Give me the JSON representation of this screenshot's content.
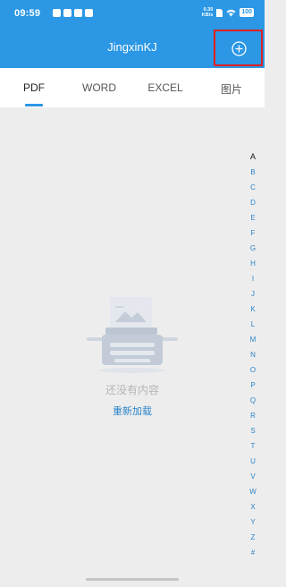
{
  "status_bar": {
    "time": "09:59",
    "speed_value": "0.30",
    "speed_unit": "KB/s",
    "battery": "100"
  },
  "app_bar": {
    "title": "JingxinKJ"
  },
  "tabs": [
    {
      "label": "PDF",
      "active": true
    },
    {
      "label": "WORD",
      "active": false
    },
    {
      "label": "EXCEL",
      "active": false
    },
    {
      "label": "图片",
      "active": false
    }
  ],
  "empty_state": {
    "message": "还没有内容",
    "reload_label": "重新加载"
  },
  "index_bar": [
    "A",
    "B",
    "C",
    "D",
    "E",
    "F",
    "G",
    "H",
    "I",
    "J",
    "K",
    "L",
    "M",
    "N",
    "O",
    "P",
    "Q",
    "R",
    "S",
    "T",
    "U",
    "V",
    "W",
    "X",
    "Y",
    "Z",
    "#"
  ],
  "colors": {
    "brand_blue": "#2b97e5",
    "highlight_red": "#e02020",
    "link_blue": "#2b84c8"
  }
}
